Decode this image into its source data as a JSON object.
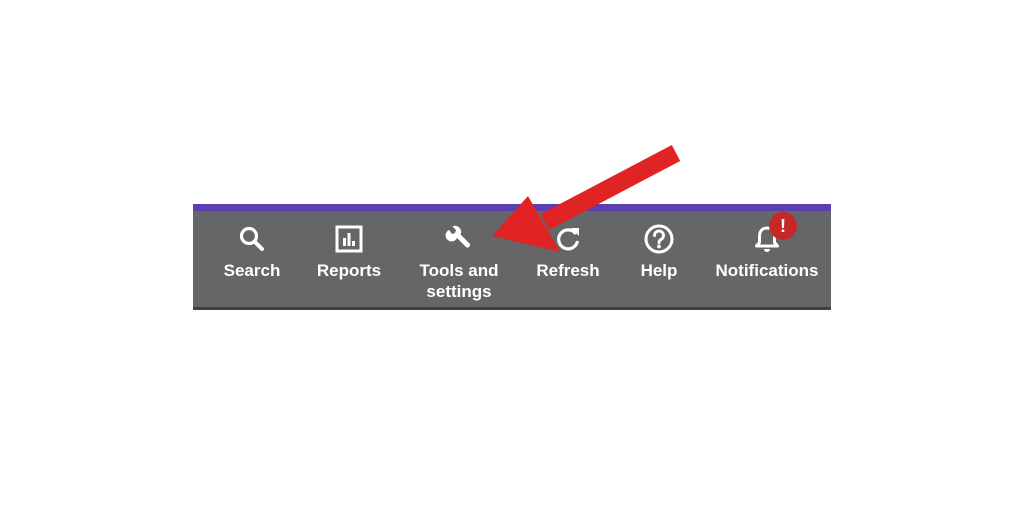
{
  "toolbar": {
    "accent_color": "#5b3fb0",
    "background_color": "#646668",
    "items": [
      {
        "label": "Search",
        "icon": "search-icon"
      },
      {
        "label": "Reports",
        "icon": "reports-icon"
      },
      {
        "label": "Tools and settings",
        "icon": "wrench-icon"
      },
      {
        "label": "Refresh",
        "icon": "refresh-icon"
      },
      {
        "label": "Help",
        "icon": "help-icon"
      },
      {
        "label": "Notifications",
        "icon": "bell-icon",
        "badge": "!"
      }
    ]
  },
  "annotation": {
    "arrow_color": "#e02424",
    "points_to": "Tools and settings"
  }
}
